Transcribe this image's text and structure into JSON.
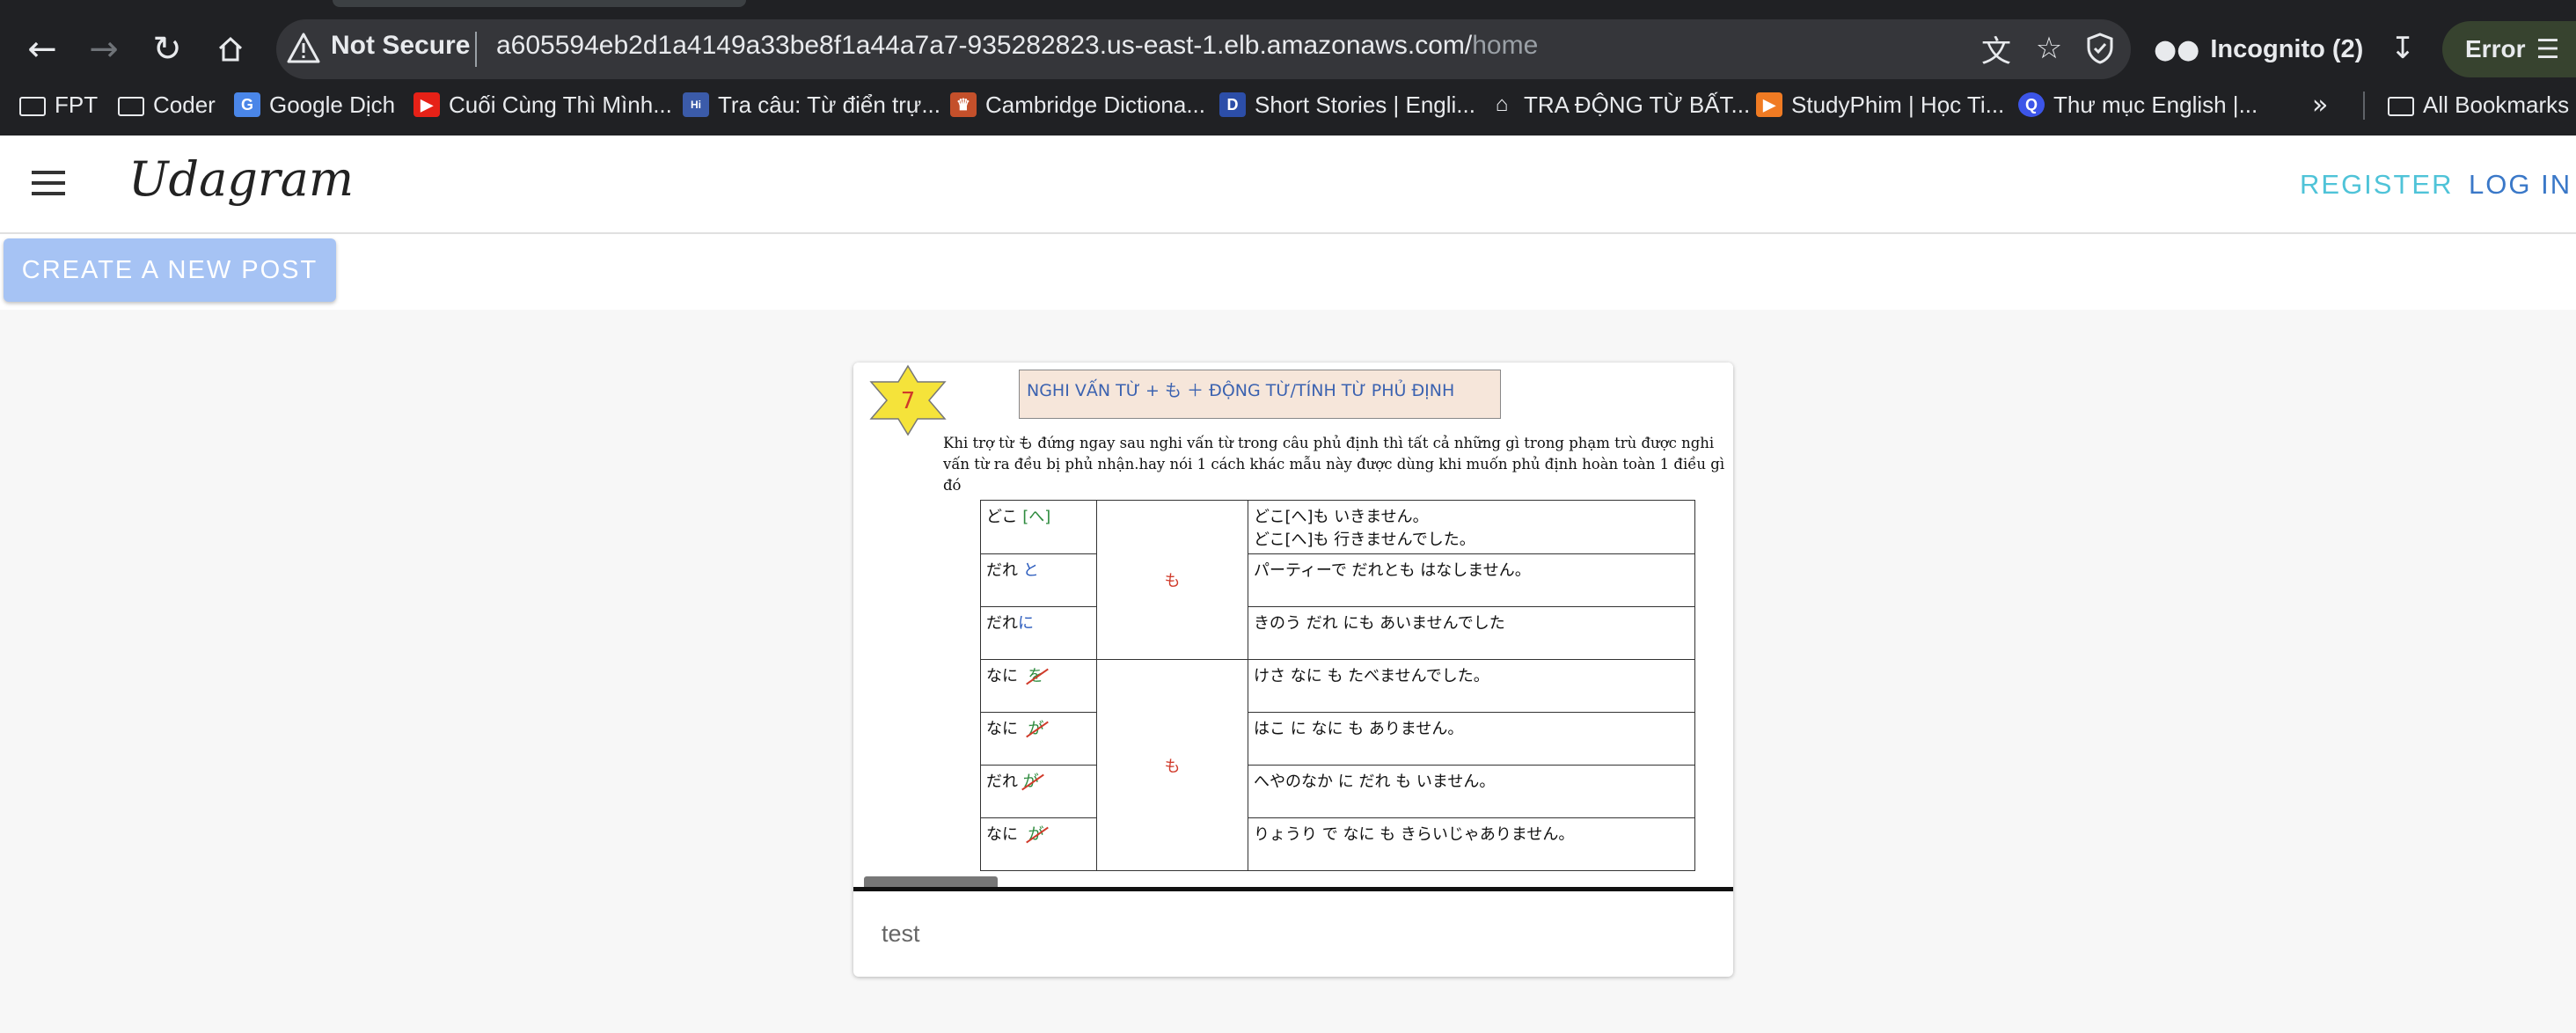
{
  "browser": {
    "security_label": "Not Secure",
    "url_host": "a605594eb2d1a4149a33be8f1a44a7a7-935282823.us-east-1.elb.amazonaws.com/",
    "url_path": "home",
    "incognito_label": "Incognito (2)",
    "error_label": "Error",
    "bookmarks": [
      {
        "label": "FPT",
        "icon": "folder-icon"
      },
      {
        "label": "Coder",
        "icon": "folder-icon"
      },
      {
        "label": "Google Dịch",
        "icon": "google-translate-icon"
      },
      {
        "label": "Cuối Cùng Thì Mình...",
        "icon": "youtube-icon"
      },
      {
        "label": "Tra câu: Từ điển trự...",
        "icon": "hello-icon"
      },
      {
        "label": "Cambridge Dictiona...",
        "icon": "cambridge-icon"
      },
      {
        "label": "Short Stories | Engli...",
        "icon": "d-icon"
      },
      {
        "label": "TRA ĐỘNG TỪ BẤT...",
        "icon": "house-icon"
      },
      {
        "label": "StudyPhim | Học Ti...",
        "icon": "play-icon"
      },
      {
        "label": "Thư mục English |...",
        "icon": "q-icon"
      }
    ],
    "all_bookmarks_label": "All Bookmarks"
  },
  "app": {
    "brand": "Udagram",
    "register_label": "REGISTER",
    "login_label": "LOG IN",
    "create_post_label": "CREATE A NEW POST"
  },
  "post": {
    "caption": "test",
    "image": {
      "badge_number": "7",
      "heading": "NGHI VẤN TỪ + も  ＋  ĐỘNG TỪ/TÍNH TỪ  PHỦ ĐỊNH",
      "paragraph": "Khi trợ  từ も đứng ngay sau nghi vấn từ trong câu phủ định thì tất cả những gì trong phạm trù được nghi vấn từ ra đều bị phủ nhận.hay nói 1 cách khác mẫu này được dùng khi muốn phủ định hoàn toàn 1 điều gì đó",
      "group_particle_1": "も",
      "group_particle_2": "も",
      "rows": [
        {
          "w": "どこ",
          "p": "[へ]",
          "e1": "どこ[へ]も  いきません。",
          "e2": "どこ[へ]も  行きませんでした。"
        },
        {
          "w": "だれ",
          "p": "と",
          "e1": "パーティーで  だれとも  はなしません。",
          "e2": ""
        },
        {
          "w": "だれ",
          "p": "に",
          "e1": "きのう  だれ  にも  あいませんでした",
          "e2": ""
        },
        {
          "w": "なに",
          "p": "を",
          "e1": "けさ  なに  も  たべませんでした。",
          "e2": ""
        },
        {
          "w": "なに",
          "p": "が",
          "e1": "はこ  に  なに  も  ありません。",
          "e2": ""
        },
        {
          "w": "だれ",
          "p": "が",
          "e1": "へやのなか  に  だれ  も  いません。",
          "e2": ""
        },
        {
          "w": "なに",
          "p": "が",
          "e1": "りょうり  で  なに  も  きらいじゃありません。",
          "e2": ""
        }
      ]
    }
  }
}
